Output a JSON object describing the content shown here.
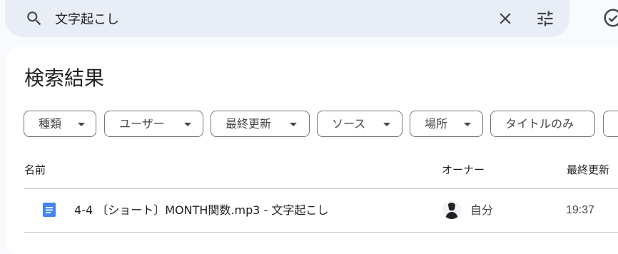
{
  "search": {
    "query": "文字起こし"
  },
  "results": {
    "title": "検索結果"
  },
  "filters": [
    {
      "label": "種類",
      "has_caret": true
    },
    {
      "label": "ユーザー",
      "has_caret": true
    },
    {
      "label": "最終更新",
      "has_caret": true
    },
    {
      "label": "ソース",
      "has_caret": true
    },
    {
      "label": "場所",
      "has_caret": true
    },
    {
      "label": "タイトルのみ",
      "has_caret": false
    }
  ],
  "columns": {
    "name": "名前",
    "owner": "オーナー",
    "modified": "最終更新"
  },
  "rows": [
    {
      "icon": "google-docs-icon",
      "name": "4-4 〔ショート〕MONTH関数.mp3 - 文字起こし",
      "owner": "自分",
      "modified": "19:37"
    }
  ],
  "colors": {
    "search_bar_bg": "#e9eef6",
    "page_bg": "#f8fafd",
    "card_bg": "#ffffff",
    "docs_blue": "#4285f4",
    "chip_border": "#747775"
  }
}
